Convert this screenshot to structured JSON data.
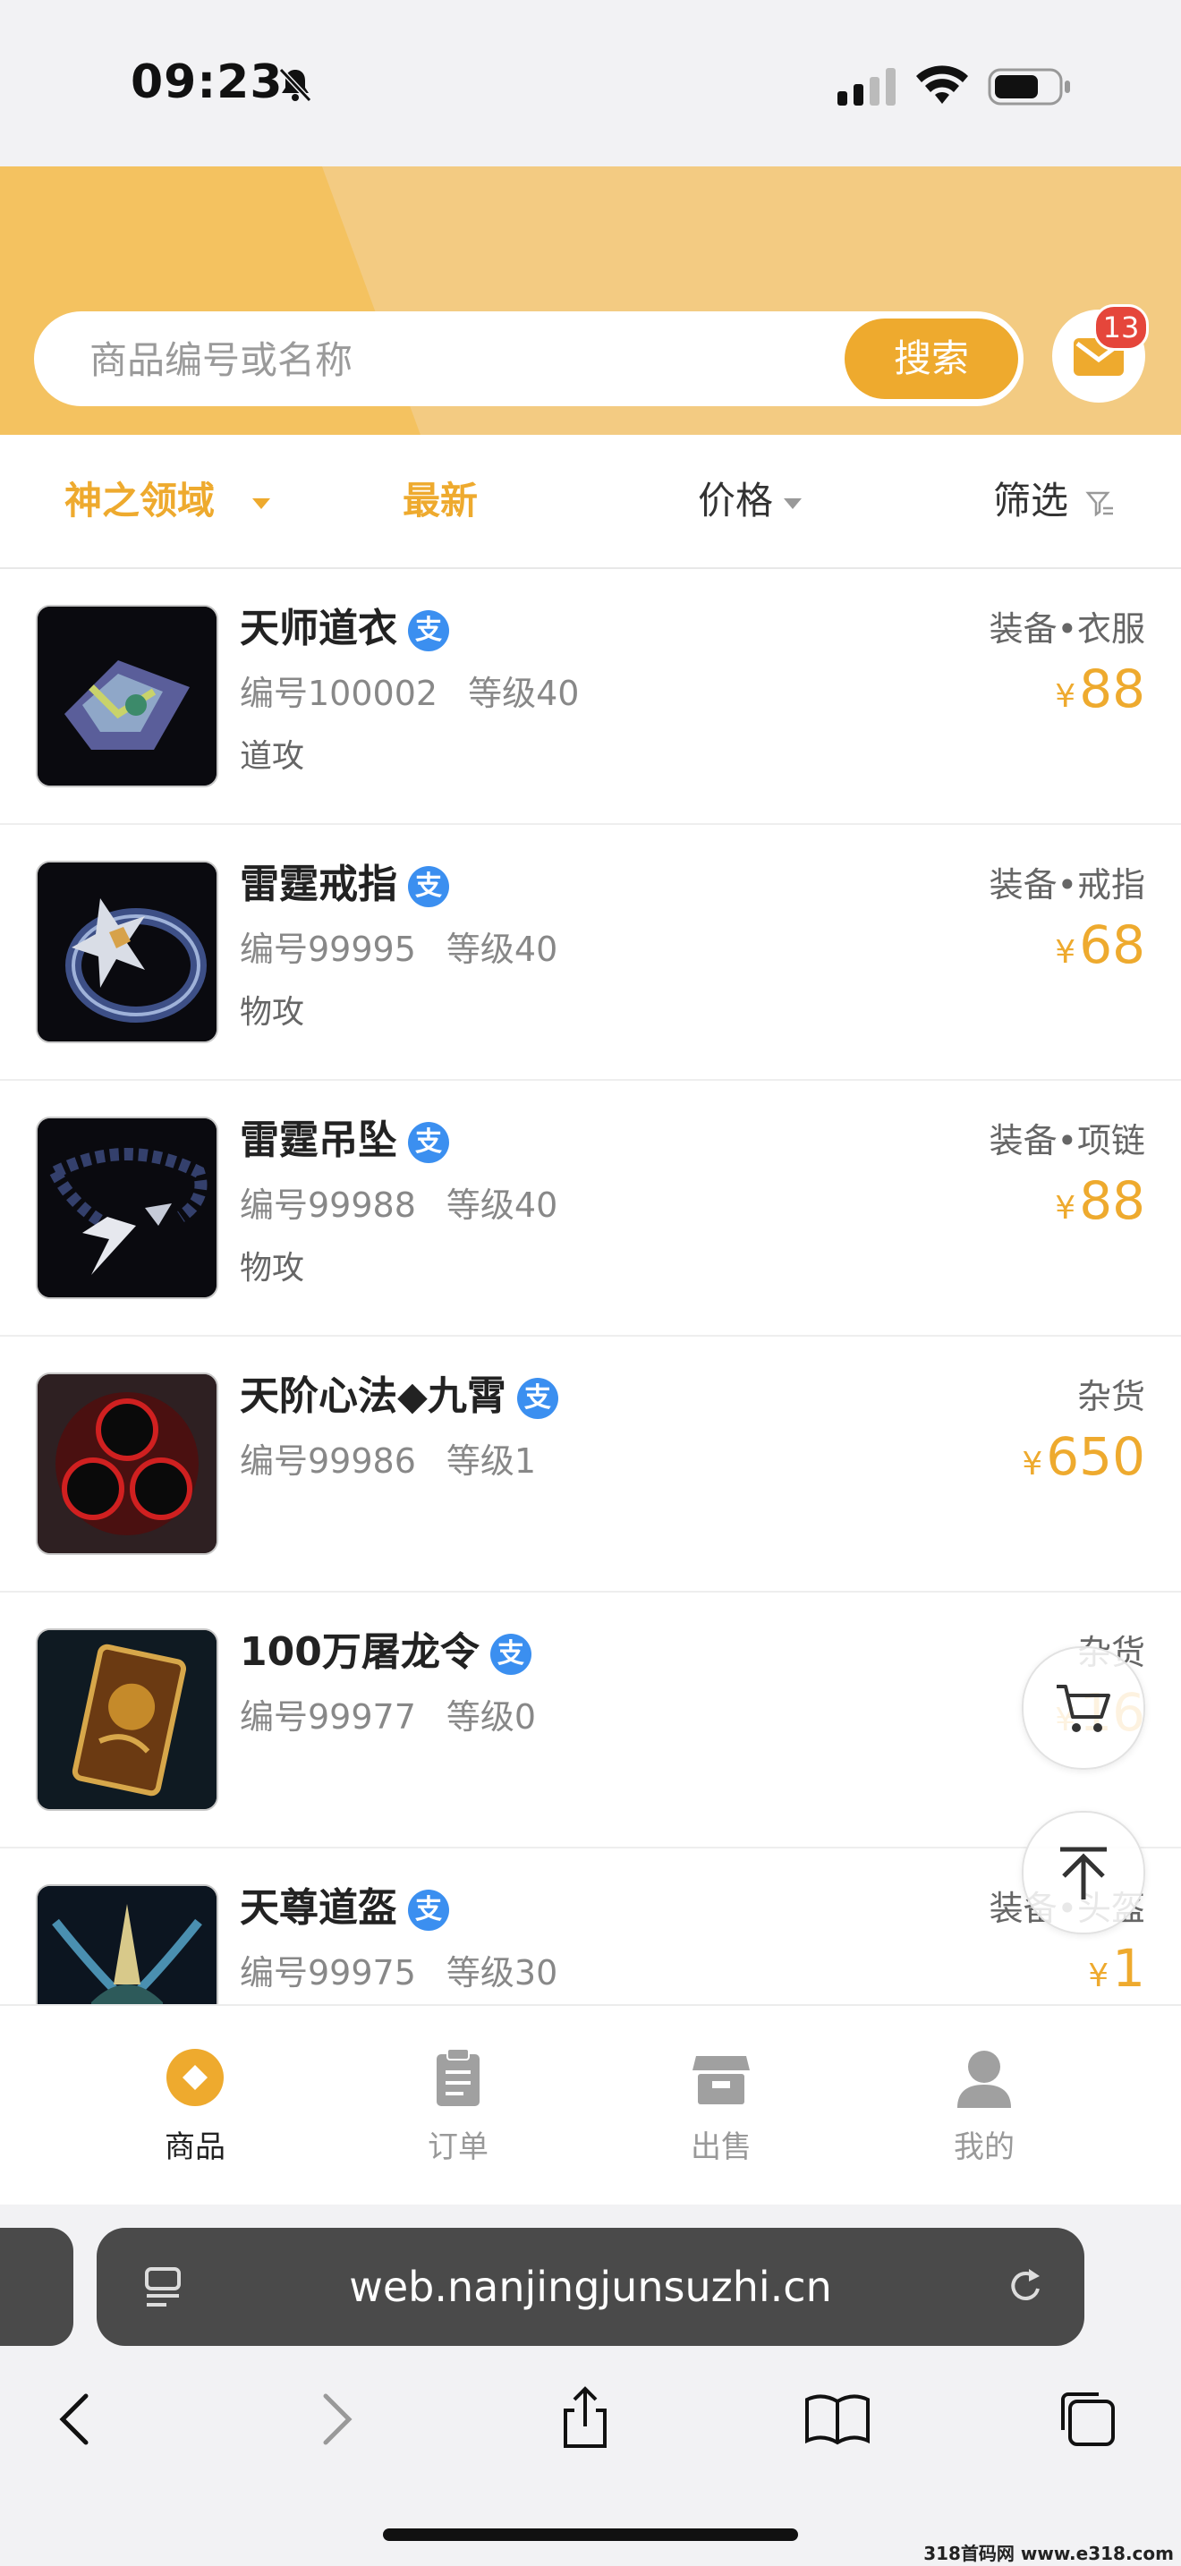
{
  "status_bar": {
    "time": "09:23"
  },
  "search": {
    "placeholder": "商品编号或名称",
    "button": "搜索",
    "mail_badge": "13"
  },
  "filters": {
    "region": "神之领域",
    "latest": "最新",
    "price": "价格",
    "screen": "筛选"
  },
  "items": [
    {
      "name": "天师道衣",
      "code": "编号100002",
      "level": "等级40",
      "tag": "道攻",
      "category": "装备•衣服",
      "price": "88"
    },
    {
      "name": "雷霆戒指",
      "code": "编号99995",
      "level": "等级40",
      "tag": "物攻",
      "category": "装备•戒指",
      "price": "68"
    },
    {
      "name": "雷霆吊坠",
      "code": "编号99988",
      "level": "等级40",
      "tag": "物攻",
      "category": "装备•项链",
      "price": "88"
    },
    {
      "name": "天阶心法◆九霄",
      "code": "编号99986",
      "level": "等级1",
      "tag": "",
      "category": "杂货",
      "price": "650"
    },
    {
      "name": "100万屠龙令",
      "code": "编号99977",
      "level": "等级0",
      "tag": "",
      "category": "杂货",
      "price": "16"
    },
    {
      "name": "天尊道盔",
      "code": "编号99975",
      "level": "等级30",
      "tag": "",
      "category": "装备•头盔",
      "price": "1"
    }
  ],
  "currency_symbol": "¥",
  "pay_badge": "支",
  "tabbar": [
    {
      "label": "商品",
      "icon": "goods-icon",
      "active": true
    },
    {
      "label": "订单",
      "icon": "clipboard-icon",
      "active": false
    },
    {
      "label": "出售",
      "icon": "store-icon",
      "active": false
    },
    {
      "label": "我的",
      "icon": "user-icon",
      "active": false
    }
  ],
  "browser": {
    "url": "web.nanjingjunsuzhi.cn"
  },
  "watermark": "318首码网 www.e318.com",
  "colors": {
    "accent": "#eeaa2e",
    "header": "#f3c877",
    "pay": "#3b8ff0",
    "badge": "#e5463b"
  }
}
